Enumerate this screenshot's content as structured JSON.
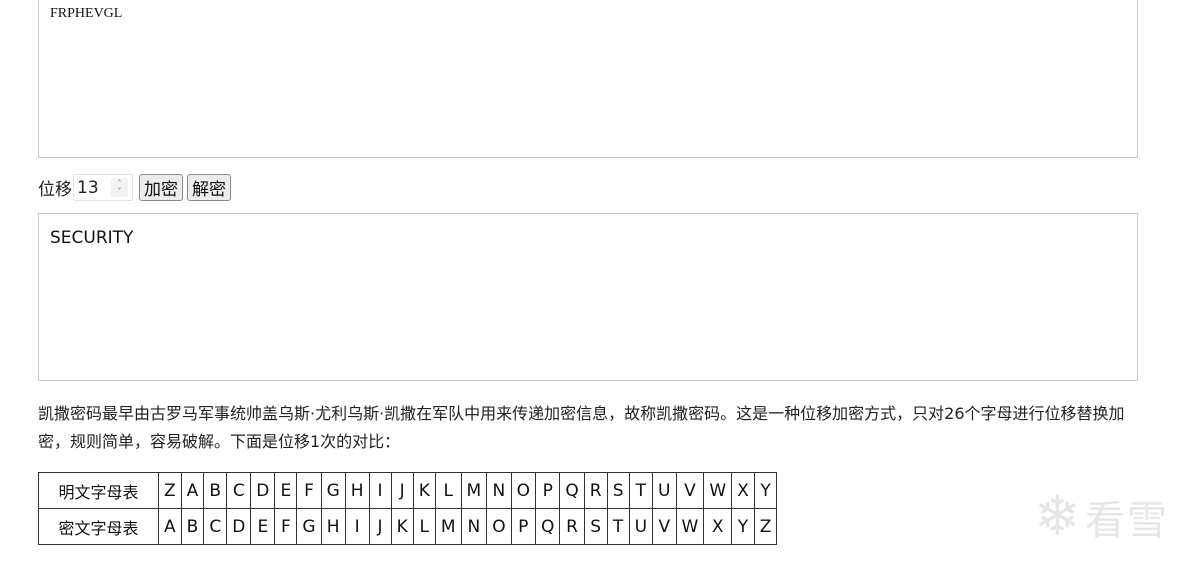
{
  "input_text": "FRPHEVGL",
  "shift": {
    "label": "位移",
    "value": "13"
  },
  "buttons": {
    "encrypt": "加密",
    "decrypt": "解密"
  },
  "output_text": "SECURITY",
  "description": "凯撒密码最早由古罗马军事统帅盖乌斯·尤利乌斯·凯撒在军队中用来传递加密信息，故称凯撒密码。这是一种位移加密方式，只对26个字母进行位移替换加密，规则简单，容易破解。下面是位移1次的对比：",
  "table": {
    "plain_label": "明文字母表",
    "cipher_label": "密文字母表",
    "plain": [
      "Z",
      "A",
      "B",
      "C",
      "D",
      "E",
      "F",
      "G",
      "H",
      "I",
      "J",
      "K",
      "L",
      "M",
      "N",
      "O",
      "P",
      "Q",
      "R",
      "S",
      "T",
      "U",
      "V",
      "W",
      "X",
      "Y"
    ],
    "cipher": [
      "A",
      "B",
      "C",
      "D",
      "E",
      "F",
      "G",
      "H",
      "I",
      "J",
      "K",
      "L",
      "M",
      "N",
      "O",
      "P",
      "Q",
      "R",
      "S",
      "T",
      "U",
      "V",
      "W",
      "X",
      "Y",
      "Z"
    ]
  },
  "watermark": {
    "icon": "snowflake-icon",
    "text": "看雪"
  }
}
